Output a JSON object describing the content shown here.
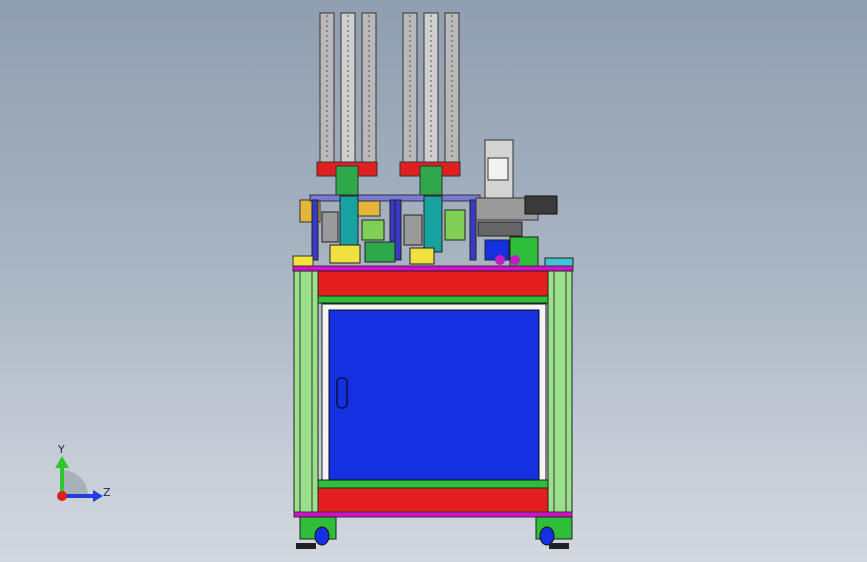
{
  "viewport": {
    "background_top": "#8f9eb0",
    "background_bottom": "#d2d8df"
  },
  "model": {
    "frame_color": "#9be08a",
    "door_color": "#1530e0",
    "rail_color": "#e41e1e",
    "accent_color": "#d40fd0",
    "cylinder_color": "#c9c9c9"
  },
  "triad": {
    "y_label": "Y",
    "z_label": "Z",
    "y_color": "#2ec82e",
    "z_color": "#1f3fd8",
    "x_color": "#e01f1f"
  }
}
